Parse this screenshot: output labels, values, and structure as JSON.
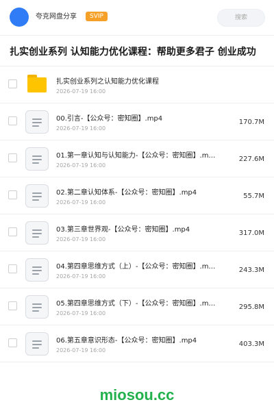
{
  "header": {
    "brand": "夸克网盘分享",
    "badge": "SVIP",
    "search_placeholder": "搜索"
  },
  "title": "扎实创业系列 认知能力优化课程：帮助更多君子 创业成功",
  "items": [
    {
      "type": "folder",
      "icon": "folder-icon",
      "name": "扎实创业系列之认知能力优化课程",
      "date": "2026-07-19 16:00",
      "size": ""
    },
    {
      "type": "file",
      "icon": "document-icon",
      "name": "00.引言-【公众号：密知圈】.mp4",
      "date": "2026-07-19 16:00",
      "size": "170.7M"
    },
    {
      "type": "file",
      "icon": "document-icon",
      "name": "01.第一章认知与认知能力-【公众号：密知圈】.m…",
      "date": "2026-07-19 16:00",
      "size": "227.6M"
    },
    {
      "type": "file",
      "icon": "document-icon",
      "name": "02.第二章认知体系-【公众号：密知圈】.mp4",
      "date": "2026-07-19 16:00",
      "size": "55.7M"
    },
    {
      "type": "file",
      "icon": "document-icon",
      "name": "03.第三章世界观-【公众号：密知圈】.mp4",
      "date": "2026-07-19 16:00",
      "size": "317.0M"
    },
    {
      "type": "file",
      "icon": "document-icon",
      "name": "04.第四章思维方式（上）-【公众号：密知圈】.m…",
      "date": "2026-07-19 16:00",
      "size": "243.3M"
    },
    {
      "type": "file",
      "icon": "document-icon",
      "name": "05.第四章思维方式（下）-【公众号：密知圈】.m…",
      "date": "2026-07-19 16:00",
      "size": "295.8M"
    },
    {
      "type": "file",
      "icon": "document-icon",
      "name": "06.第五章意识形态-【公众号：密知圈】.mp4",
      "date": "2026-07-19 16:00",
      "size": "403.3M"
    }
  ],
  "watermark": "miosou.cc",
  "colors": {
    "avatar": "#2f7cf6",
    "badge": "#f5a028",
    "folder": "#ffc400",
    "watermark": "#22b14c"
  }
}
